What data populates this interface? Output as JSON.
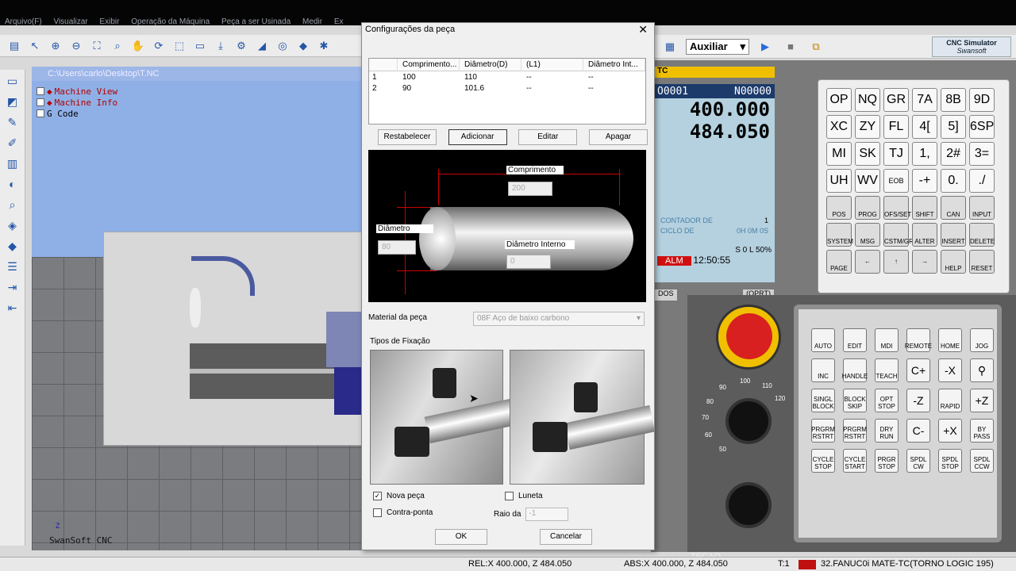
{
  "menubar": [
    "Arquivo(F)",
    "Visualizar",
    "Exibir",
    "Operação da Máquina",
    "Peça a ser Usinada",
    "Medir",
    "Ex"
  ],
  "viewport": {
    "path": "C:\\Users\\carlo\\Desktop\\T.NC",
    "tree": [
      "Machine View",
      "Machine Info",
      "G Code"
    ],
    "footer": "SwanSoft CNC",
    "axis": "Z"
  },
  "toolbar2": {
    "mode": "Auxiliar",
    "logo_line1": "CNC Simulator",
    "logo_line2": "Swansoft"
  },
  "cnc": {
    "tc": "TC",
    "prog": "O0001",
    "seq": "N00000",
    "x": "400.000",
    "z": "484.050",
    "counter": "CONTADOR DE",
    "cycle": "CICLO DE",
    "counter_val": "1",
    "cycle_val": "0H 0M 0S",
    "status_line": "S    0  L  50%",
    "alm": "ALM",
    "time": "12:50:55",
    "soft1": "DOS",
    "soft2": "(OPRT)",
    "keys": [
      "OP",
      "NQ",
      "GR",
      "7A",
      "8B",
      "9D",
      "XC",
      "ZY",
      "FL",
      "4[",
      "5]",
      "6SP",
      "MI",
      "SK",
      "TJ",
      "1,",
      "2#",
      "3=",
      "UH",
      "WV",
      "EOB",
      "-+",
      "0.",
      "./"
    ],
    "fkeys": [
      "POS",
      "PROG",
      "OFS/SET",
      "SHIFT",
      "CAN",
      "INPUT",
      "SYSTEM",
      "MSG",
      "CSTM/GR",
      "ALTER",
      "INSERT",
      "DELETE"
    ],
    "nav": [
      "PAGE",
      "PAGE",
      "HELP",
      "RESET"
    ],
    "tecao": "TECAO",
    "feed": [
      "90",
      "100",
      "110",
      "120",
      "80",
      "70",
      "60",
      "50"
    ],
    "opkeys": [
      "AUTO",
      "EDIT",
      "MDI",
      "REMOTE",
      "HOME",
      "JOG",
      "INC",
      "HANDLE",
      "TEACH",
      "C+",
      "-X",
      "",
      "SINGL BLOCK",
      "BLOCK SKIP",
      "OPT STOP",
      "-Z",
      "RAPID",
      "+Z",
      "PRGRM RSTRT",
      "PRGRM RSTRT",
      "DRY RUN",
      "C-",
      "+X",
      "BY PASS",
      "CYCLE STOP",
      "CYCLE START",
      "PRGR STOP",
      "SPDL CW",
      "SPDL STOP",
      "SPDL CCW"
    ]
  },
  "dialog": {
    "title": "Configurações da peça",
    "columns": [
      "",
      "Comprimento...",
      "Diâmetro(D)",
      "(L1)",
      "Diâmetro Int..."
    ],
    "rows": [
      [
        "1",
        "100",
        "110",
        "--",
        "--"
      ],
      [
        "2",
        "90",
        "101.6",
        "--",
        "--"
      ]
    ],
    "buttons": [
      "Restabelecer",
      "Adicionar",
      "Editar",
      "Apagar"
    ],
    "labels": {
      "length": "Comprimento",
      "diameter": "Diâmetro",
      "inner": "Diâmetro Interno"
    },
    "values": {
      "length": "200",
      "diameter": "80",
      "inner": "0"
    },
    "material_label": "Material da peça",
    "material": "08F Aço de baixo carbono",
    "fixture_label": "Tipos de Fixação",
    "nova_peca": "Nova peça",
    "luneta": "Luneta",
    "contra_ponta": "Contra-ponta",
    "raio_label": "Raio da",
    "raio_val": "-1",
    "ok": "OK",
    "cancel": "Cancelar"
  },
  "status": {
    "rel": "REL:X  400.000, Z  484.050",
    "abs": "ABS:X  400.000, Z  484.050",
    "tool": "T:1",
    "machine": "32.FANUC0i MATE-TC(TORNO LOGIC 195)"
  }
}
